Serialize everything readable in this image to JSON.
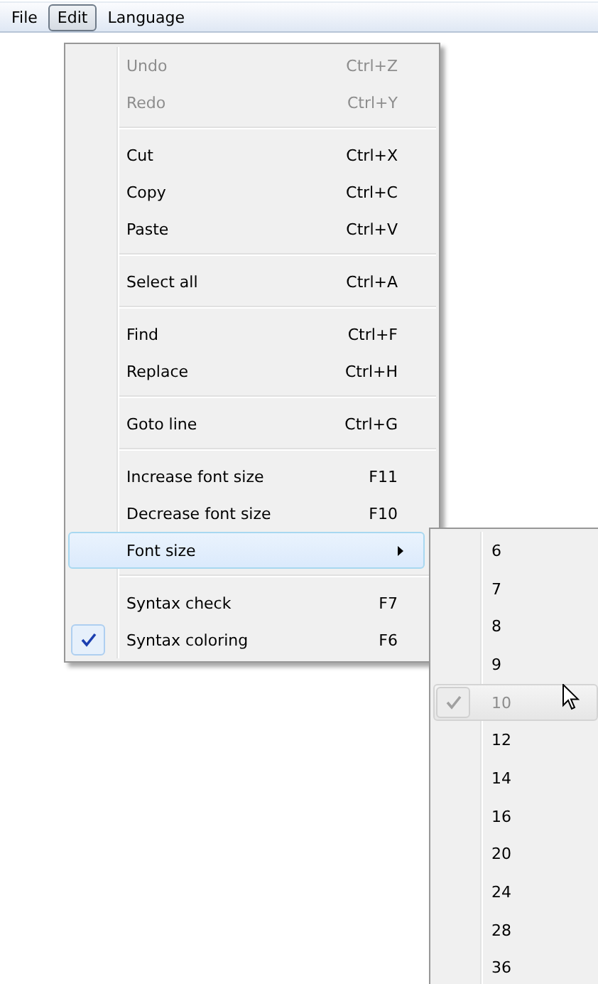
{
  "menubar": [
    {
      "label": "File",
      "selected": false
    },
    {
      "label": "Edit",
      "selected": true
    },
    {
      "label": "Language",
      "selected": false
    }
  ],
  "edit_menu": {
    "groups": [
      [
        {
          "label": "Undo",
          "shortcut": "Ctrl+Z",
          "disabled": true,
          "checked": false,
          "selected": false,
          "has_submenu": false
        },
        {
          "label": "Redo",
          "shortcut": "Ctrl+Y",
          "disabled": true,
          "checked": false,
          "selected": false,
          "has_submenu": false
        }
      ],
      [
        {
          "label": "Cut",
          "shortcut": "Ctrl+X",
          "disabled": false,
          "checked": false,
          "selected": false,
          "has_submenu": false
        },
        {
          "label": "Copy",
          "shortcut": "Ctrl+C",
          "disabled": false,
          "checked": false,
          "selected": false,
          "has_submenu": false
        },
        {
          "label": "Paste",
          "shortcut": "Ctrl+V",
          "disabled": false,
          "checked": false,
          "selected": false,
          "has_submenu": false
        }
      ],
      [
        {
          "label": "Select all",
          "shortcut": "Ctrl+A",
          "disabled": false,
          "checked": false,
          "selected": false,
          "has_submenu": false
        }
      ],
      [
        {
          "label": "Find",
          "shortcut": "Ctrl+F",
          "disabled": false,
          "checked": false,
          "selected": false,
          "has_submenu": false
        },
        {
          "label": "Replace",
          "shortcut": "Ctrl+H",
          "disabled": false,
          "checked": false,
          "selected": false,
          "has_submenu": false
        }
      ],
      [
        {
          "label": "Goto line",
          "shortcut": "Ctrl+G",
          "disabled": false,
          "checked": false,
          "selected": false,
          "has_submenu": false
        }
      ],
      [
        {
          "label": "Increase font size",
          "shortcut": "F11",
          "disabled": false,
          "checked": false,
          "selected": false,
          "has_submenu": false
        },
        {
          "label": "Decrease font size",
          "shortcut": "F10",
          "disabled": false,
          "checked": false,
          "selected": false,
          "has_submenu": false
        },
        {
          "label": "Font size",
          "disabled": false,
          "checked": false,
          "selected": true,
          "has_submenu": true
        }
      ],
      [
        {
          "label": "Syntax check",
          "shortcut": "F7",
          "disabled": false,
          "checked": false,
          "selected": false,
          "has_submenu": false
        },
        {
          "label": "Syntax coloring",
          "shortcut": "F6",
          "disabled": false,
          "checked": true,
          "selected": false,
          "has_submenu": false
        }
      ]
    ]
  },
  "font_size_menu": {
    "items": [
      {
        "label": "6",
        "checked": false,
        "disabled": false,
        "selected": false
      },
      {
        "label": "7",
        "checked": false,
        "disabled": false,
        "selected": false
      },
      {
        "label": "8",
        "checked": false,
        "disabled": false,
        "selected": false
      },
      {
        "label": "9",
        "checked": false,
        "disabled": false,
        "selected": false
      },
      {
        "label": "10",
        "checked": true,
        "disabled": true,
        "selected": true
      },
      {
        "label": "12",
        "checked": false,
        "disabled": false,
        "selected": false
      },
      {
        "label": "14",
        "checked": false,
        "disabled": false,
        "selected": false
      },
      {
        "label": "16",
        "checked": false,
        "disabled": false,
        "selected": false
      },
      {
        "label": "20",
        "checked": false,
        "disabled": false,
        "selected": false
      },
      {
        "label": "24",
        "checked": false,
        "disabled": false,
        "selected": false
      },
      {
        "label": "28",
        "checked": false,
        "disabled": false,
        "selected": false
      },
      {
        "label": "36",
        "checked": false,
        "disabled": false,
        "selected": false
      }
    ]
  }
}
